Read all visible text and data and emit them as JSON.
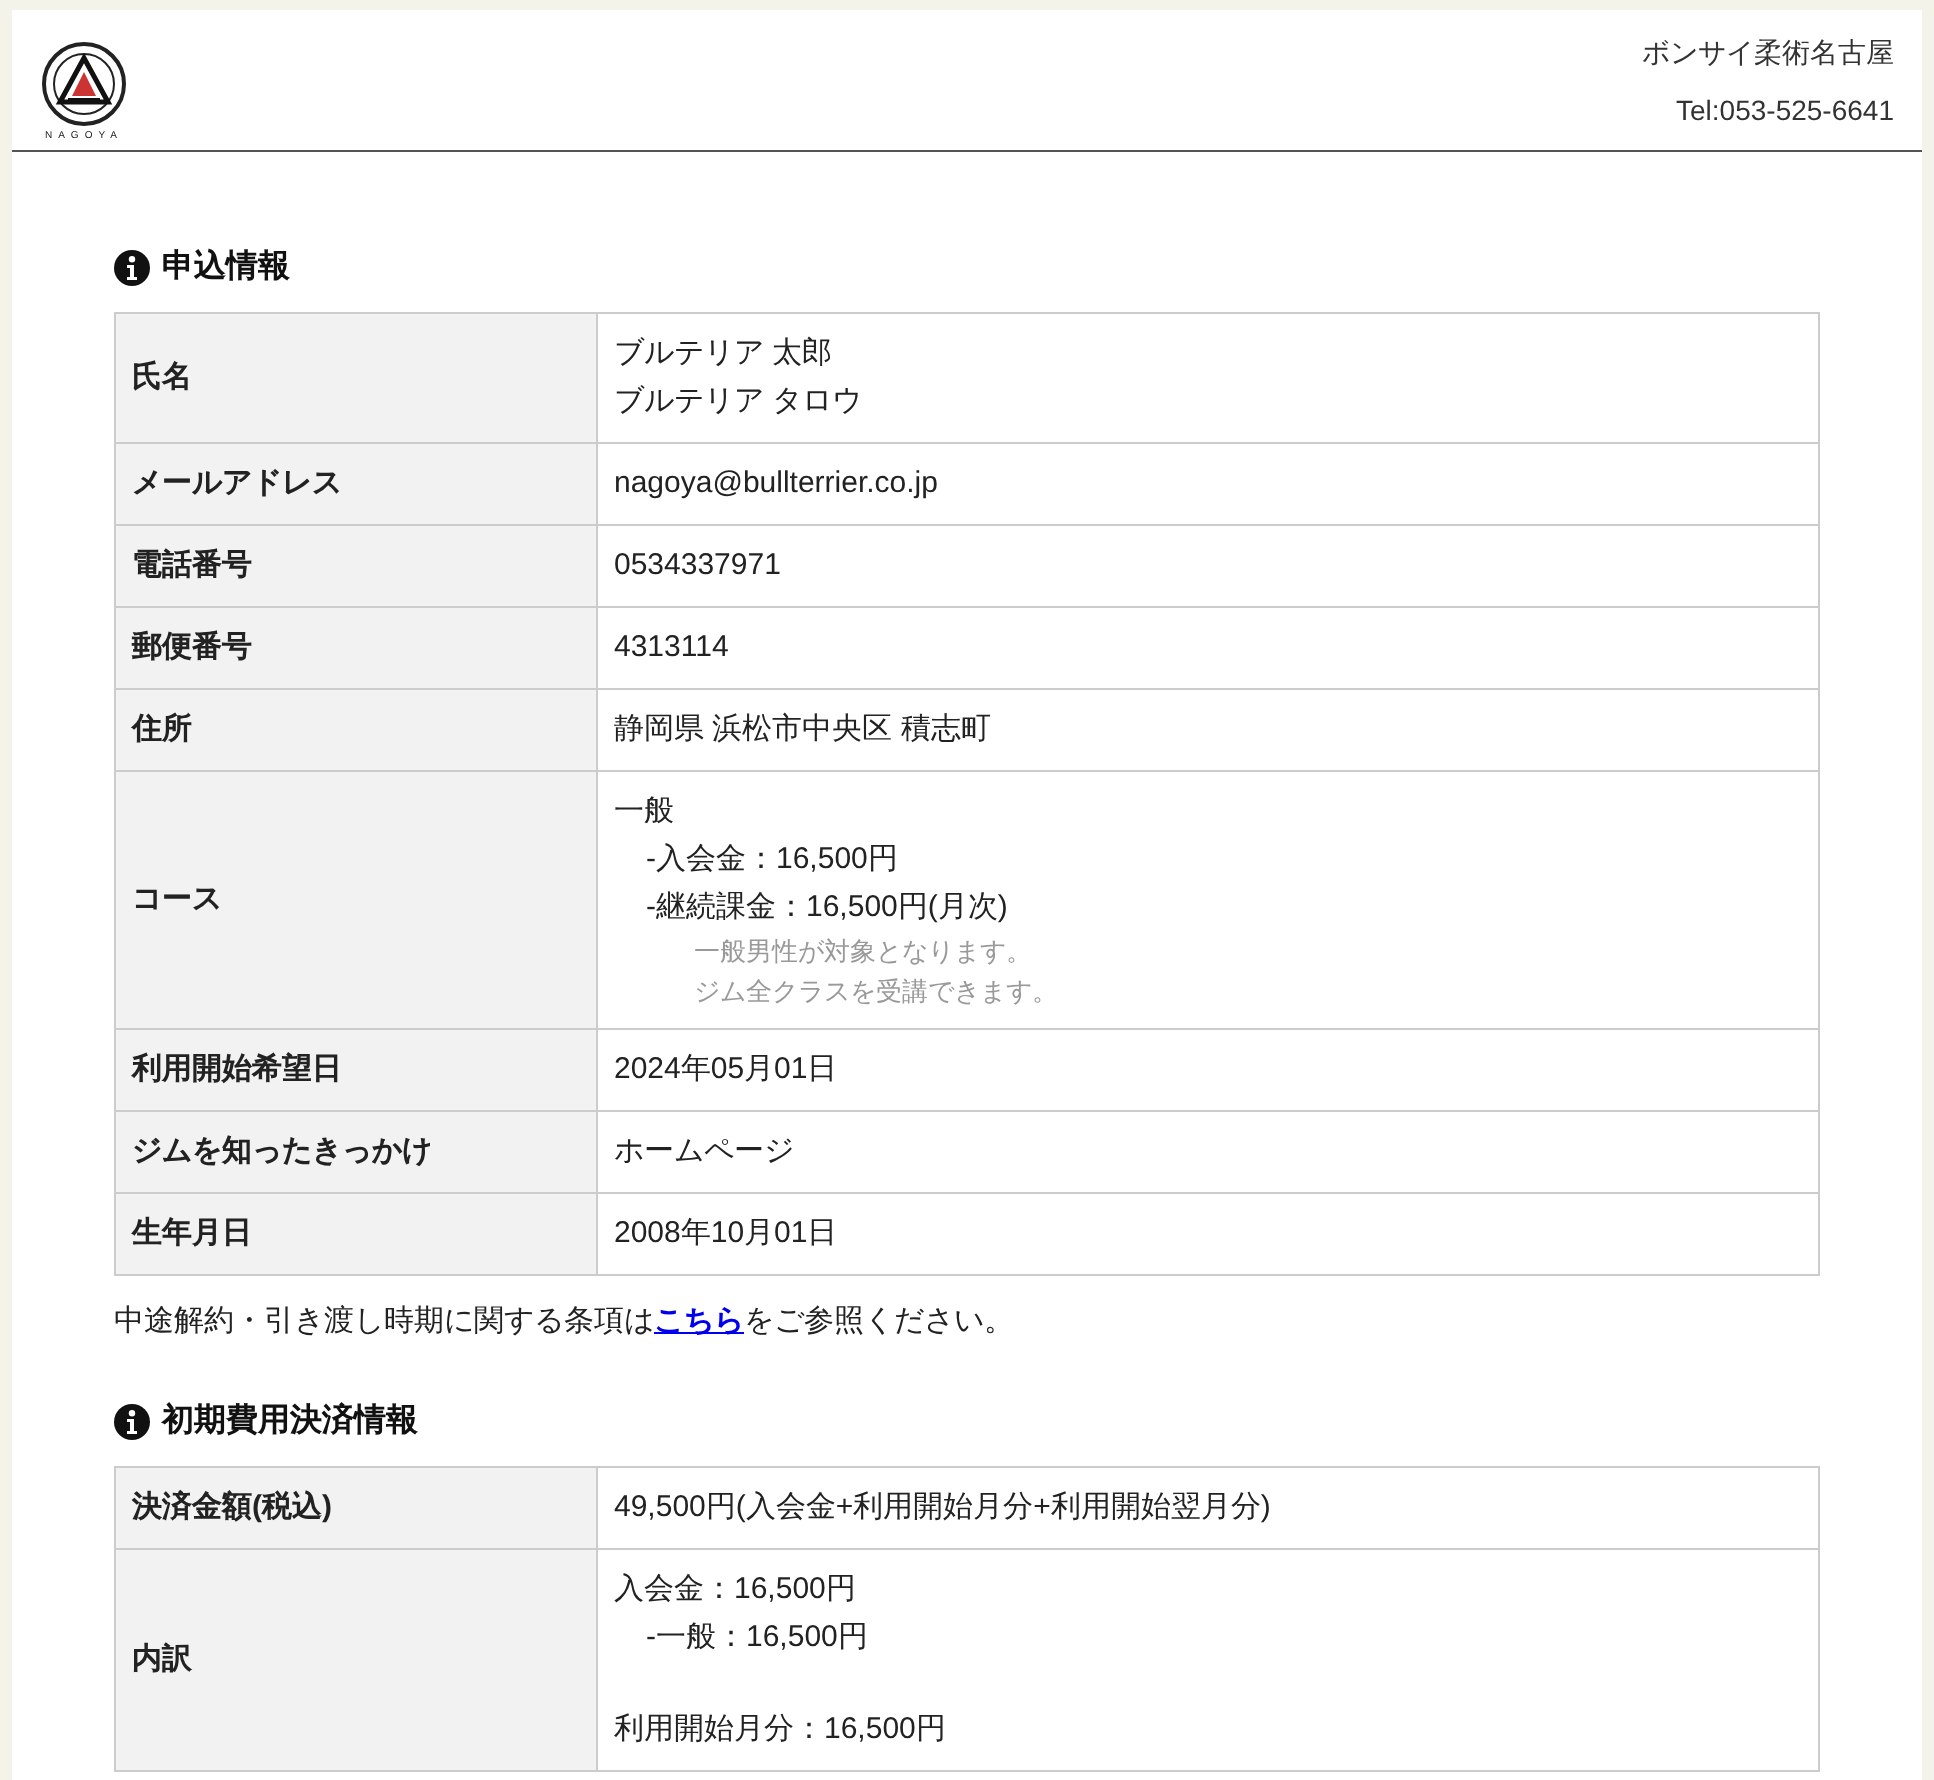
{
  "header": {
    "logo_caption": "NAGOYA",
    "gym_name": "ボンサイ柔術名古屋",
    "phone": "Tel:053-525-6641"
  },
  "sections": [
    {
      "title": "申込情報",
      "rows": [
        {
          "label": "氏名",
          "lines": [
            {
              "kind": "plain",
              "text": "ブルテリア 太郎"
            },
            {
              "kind": "plain",
              "text": "ブルテリア タロウ"
            }
          ]
        },
        {
          "label": "メールアドレス",
          "lines": [
            {
              "kind": "plain",
              "text": "nagoya@bullterrier.co.jp"
            }
          ]
        },
        {
          "label": "電話番号",
          "lines": [
            {
              "kind": "plain",
              "text": "0534337971"
            }
          ]
        },
        {
          "label": "郵便番号",
          "lines": [
            {
              "kind": "plain",
              "text": "4313114"
            }
          ]
        },
        {
          "label": "住所",
          "lines": [
            {
              "kind": "plain",
              "text": "静岡県 浜松市中央区 積志町"
            }
          ]
        },
        {
          "label": "コース",
          "lines": [
            {
              "kind": "plain",
              "text": "一般"
            },
            {
              "kind": "indent",
              "text": "-入会金：16,500円"
            },
            {
              "kind": "indent",
              "text": "-継続課金：16,500円(月次)"
            },
            {
              "kind": "note",
              "text": "一般男性が対象となります。"
            },
            {
              "kind": "note",
              "text": "ジム全クラスを受講できます。"
            }
          ]
        },
        {
          "label": "利用開始希望日",
          "lines": [
            {
              "kind": "plain",
              "text": "2024年05月01日"
            }
          ]
        },
        {
          "label": "ジムを知ったきっかけ",
          "lines": [
            {
              "kind": "plain",
              "text": "ホームページ"
            }
          ]
        },
        {
          "label": "生年月日",
          "lines": [
            {
              "kind": "plain",
              "text": "2008年10月01日"
            }
          ]
        }
      ],
      "notice": {
        "before": "中途解約・引き渡し時期に関する条項は",
        "link": "こちら",
        "after": "をご参照ください。"
      }
    },
    {
      "title": "初期費用決済情報",
      "rows": [
        {
          "label": "決済金額(税込)",
          "lines": [
            {
              "kind": "plain",
              "text": "49,500円(入会金+利用開始月分+利用開始翌月分)"
            }
          ]
        },
        {
          "label": "内訳",
          "lines": [
            {
              "kind": "plain",
              "text": "入会金：16,500円"
            },
            {
              "kind": "indent",
              "text": "-一般：16,500円"
            },
            {
              "kind": "spaced",
              "text": "利用開始月分：16,500円"
            }
          ]
        }
      ]
    }
  ]
}
